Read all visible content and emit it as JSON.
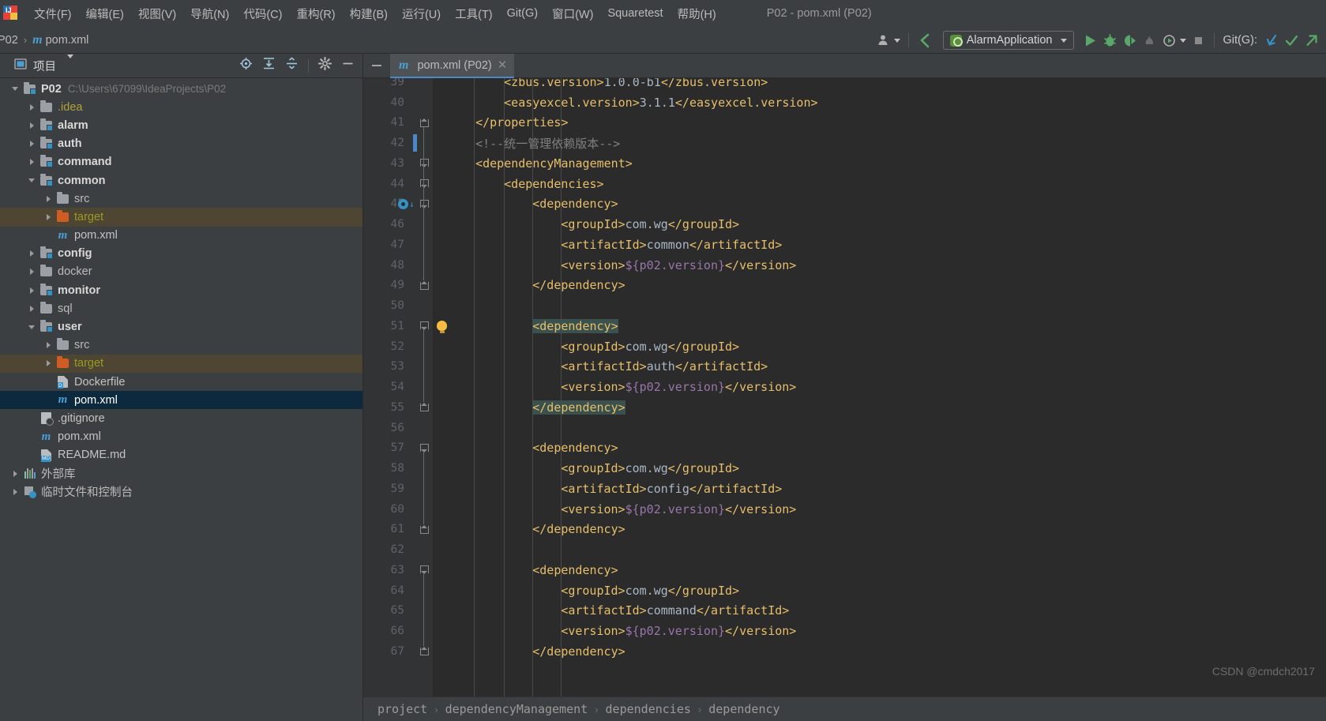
{
  "window": {
    "title": "P02 - pom.xml (P02)"
  },
  "menubar": {
    "logo": "intellij-idea-logo",
    "items": [
      "文件(F)",
      "编辑(E)",
      "视图(V)",
      "导航(N)",
      "代码(C)",
      "重构(R)",
      "构建(B)",
      "运行(U)",
      "工具(T)",
      "Git(G)",
      "窗口(W)",
      "Squaretest",
      "帮助(H)"
    ]
  },
  "navbar": {
    "breadcrumbs": [
      "P02",
      "pom.xml"
    ],
    "separator": "›",
    "toolbar": {
      "user_icon": "user-avatar-icon",
      "back_icon": "back-arrow-icon",
      "run_config": "AlarmApplication",
      "run_icon": "run-icon",
      "debug_icon": "debug-icon",
      "run_coverage_icon": "run-with-coverage-icon",
      "profiler_icon": "profiler-icon",
      "more_run_icon": "run-more-icon",
      "stop_icon": "stop-icon",
      "git_label": "Git(G):",
      "git_update_icon": "git-update-project-icon",
      "git_commit_icon": "git-commit-icon",
      "git_push_icon": "git-push-icon"
    }
  },
  "project_panel": {
    "title": "项目",
    "view_icon": "project-view-icon",
    "dropdown_icon": "chevron-down-icon",
    "actions": [
      "scroll-from-source-icon",
      "expand-all-icon",
      "collapse-all-icon",
      "settings-gear-icon",
      "hide-panel-icon"
    ],
    "tree": [
      {
        "label": "P02",
        "path": "C:\\Users\\67099\\IdeaProjects\\P02",
        "depth": 0,
        "twisty": "down",
        "icon": "module-folder-icon",
        "style": "bold"
      },
      {
        "label": ".idea",
        "depth": 1,
        "twisty": "right",
        "icon": "folder-icon",
        "style": "idea"
      },
      {
        "label": "alarm",
        "depth": 1,
        "twisty": "right",
        "icon": "module-folder-icon",
        "style": "bold"
      },
      {
        "label": "auth",
        "depth": 1,
        "twisty": "right",
        "icon": "module-folder-icon",
        "style": "bold"
      },
      {
        "label": "command",
        "depth": 1,
        "twisty": "right",
        "icon": "module-folder-icon",
        "style": "bold"
      },
      {
        "label": "common",
        "depth": 1,
        "twisty": "down",
        "icon": "module-folder-icon",
        "style": "bold"
      },
      {
        "label": "src",
        "depth": 2,
        "twisty": "right",
        "icon": "folder-icon",
        "style": "plain"
      },
      {
        "label": "target",
        "depth": 2,
        "twisty": "right",
        "icon": "excluded-folder-icon",
        "style": "excluded",
        "row": "excluded"
      },
      {
        "label": "pom.xml",
        "depth": 2,
        "twisty": "none",
        "icon": "maven-file-icon",
        "style": "file"
      },
      {
        "label": "config",
        "depth": 1,
        "twisty": "right",
        "icon": "module-folder-icon",
        "style": "bold"
      },
      {
        "label": "docker",
        "depth": 1,
        "twisty": "right",
        "icon": "folder-icon",
        "style": "plain"
      },
      {
        "label": "monitor",
        "depth": 1,
        "twisty": "right",
        "icon": "module-folder-icon",
        "style": "bold"
      },
      {
        "label": "sql",
        "depth": 1,
        "twisty": "right",
        "icon": "folder-icon",
        "style": "plain"
      },
      {
        "label": "user",
        "depth": 1,
        "twisty": "down",
        "icon": "module-folder-icon",
        "style": "bold"
      },
      {
        "label": "src",
        "depth": 2,
        "twisty": "right",
        "icon": "folder-icon",
        "style": "plain"
      },
      {
        "label": "target",
        "depth": 2,
        "twisty": "right",
        "icon": "excluded-folder-icon",
        "style": "excluded",
        "row": "excluded"
      },
      {
        "label": "Dockerfile",
        "depth": 2,
        "twisty": "none",
        "icon": "dockerfile-icon",
        "style": "file"
      },
      {
        "label": "pom.xml",
        "depth": 2,
        "twisty": "none",
        "icon": "maven-file-icon",
        "style": "file",
        "row": "selected"
      },
      {
        "label": ".gitignore",
        "depth": 1,
        "twisty": "none",
        "icon": "gitignore-icon",
        "style": "file"
      },
      {
        "label": "pom.xml",
        "depth": 1,
        "twisty": "none",
        "icon": "maven-file-icon",
        "style": "file"
      },
      {
        "label": "README.md",
        "depth": 1,
        "twisty": "none",
        "icon": "markdown-icon",
        "style": "file"
      },
      {
        "label": "外部库",
        "depth": 0,
        "twisty": "right",
        "icon": "external-libraries-icon",
        "style": "plain"
      },
      {
        "label": "临时文件和控制台",
        "depth": 0,
        "twisty": "right",
        "icon": "scratches-consoles-icon",
        "style": "plain"
      }
    ]
  },
  "editor": {
    "minimize_icon": "minimize-icon",
    "tab": {
      "label": "pom.xml (P02)",
      "icon": "maven-file-icon",
      "close_icon": "close-icon"
    },
    "first_line_number": 39,
    "lines": [
      {
        "n": 39,
        "indent": 8,
        "marker": "",
        "tokens": [
          {
            "t": "tag",
            "v": "<zbus.version>"
          },
          {
            "t": "txt",
            "v": "1.0.0-b1"
          },
          {
            "t": "tag",
            "v": "</zbus.version>"
          }
        ]
      },
      {
        "n": 40,
        "indent": 8,
        "marker": "",
        "tokens": [
          {
            "t": "tag",
            "v": "<easyexcel.version>"
          },
          {
            "t": "txt",
            "v": "3.1.1"
          },
          {
            "t": "tag",
            "v": "</easyexcel.version>"
          }
        ]
      },
      {
        "n": 41,
        "indent": 4,
        "marker": "fold-close",
        "tokens": [
          {
            "t": "tag",
            "v": "</properties>"
          }
        ]
      },
      {
        "n": 42,
        "indent": 4,
        "marker": "",
        "change": true,
        "tokens": [
          {
            "t": "cmt",
            "v": "<!--统一管理依赖版本-->"
          }
        ]
      },
      {
        "n": 43,
        "indent": 4,
        "marker": "fold-open",
        "tokens": [
          {
            "t": "tag",
            "v": "<dependencyManagement>"
          }
        ]
      },
      {
        "n": 44,
        "indent": 8,
        "marker": "fold-open",
        "tokens": [
          {
            "t": "tag",
            "v": "<dependencies>"
          }
        ]
      },
      {
        "n": 45,
        "indent": 12,
        "marker": "fold-open",
        "maven_nav": true,
        "tokens": [
          {
            "t": "tag",
            "v": "<dependency>"
          }
        ]
      },
      {
        "n": 46,
        "indent": 16,
        "marker": "",
        "tokens": [
          {
            "t": "tag",
            "v": "<groupId>"
          },
          {
            "t": "txt",
            "v": "com.wg"
          },
          {
            "t": "tag",
            "v": "</groupId>"
          }
        ]
      },
      {
        "n": 47,
        "indent": 16,
        "marker": "",
        "tokens": [
          {
            "t": "tag",
            "v": "<artifactId>"
          },
          {
            "t": "txt",
            "v": "common"
          },
          {
            "t": "tag",
            "v": "</artifactId>"
          }
        ]
      },
      {
        "n": 48,
        "indent": 16,
        "marker": "",
        "tokens": [
          {
            "t": "tag",
            "v": "<version>"
          },
          {
            "t": "var",
            "v": "${p02.version}"
          },
          {
            "t": "tag",
            "v": "</version>"
          }
        ]
      },
      {
        "n": 49,
        "indent": 12,
        "marker": "fold-close",
        "tokens": [
          {
            "t": "tag",
            "v": "</dependency>"
          }
        ]
      },
      {
        "n": 50,
        "indent": 0,
        "marker": "",
        "tokens": []
      },
      {
        "n": 51,
        "indent": 12,
        "marker": "fold-open",
        "bulb": true,
        "highlight": true,
        "tokens": [
          {
            "t": "tag",
            "v": "<dependency>"
          }
        ]
      },
      {
        "n": 52,
        "indent": 16,
        "marker": "",
        "tokens": [
          {
            "t": "tag",
            "v": "<groupId>"
          },
          {
            "t": "txt",
            "v": "com.wg"
          },
          {
            "t": "tag",
            "v": "</groupId>"
          }
        ]
      },
      {
        "n": 53,
        "indent": 16,
        "marker": "",
        "tokens": [
          {
            "t": "tag",
            "v": "<artifactId>"
          },
          {
            "t": "txt",
            "v": "auth"
          },
          {
            "t": "tag",
            "v": "</artifactId>"
          }
        ]
      },
      {
        "n": 54,
        "indent": 16,
        "marker": "",
        "tokens": [
          {
            "t": "tag",
            "v": "<version>"
          },
          {
            "t": "var",
            "v": "${p02.version}"
          },
          {
            "t": "tag",
            "v": "</version>"
          }
        ]
      },
      {
        "n": 55,
        "indent": 12,
        "marker": "fold-close",
        "highlight": true,
        "tokens": [
          {
            "t": "tag",
            "v": "</dependency>"
          }
        ]
      },
      {
        "n": 56,
        "indent": 0,
        "marker": "",
        "tokens": []
      },
      {
        "n": 57,
        "indent": 12,
        "marker": "fold-open",
        "tokens": [
          {
            "t": "tag",
            "v": "<dependency>"
          }
        ]
      },
      {
        "n": 58,
        "indent": 16,
        "marker": "",
        "tokens": [
          {
            "t": "tag",
            "v": "<groupId>"
          },
          {
            "t": "txt",
            "v": "com.wg"
          },
          {
            "t": "tag",
            "v": "</groupId>"
          }
        ]
      },
      {
        "n": 59,
        "indent": 16,
        "marker": "",
        "tokens": [
          {
            "t": "tag",
            "v": "<artifactId>"
          },
          {
            "t": "txt",
            "v": "config"
          },
          {
            "t": "tag",
            "v": "</artifactId>"
          }
        ]
      },
      {
        "n": 60,
        "indent": 16,
        "marker": "",
        "tokens": [
          {
            "t": "tag",
            "v": "<version>"
          },
          {
            "t": "var",
            "v": "${p02.version}"
          },
          {
            "t": "tag",
            "v": "</version>"
          }
        ]
      },
      {
        "n": 61,
        "indent": 12,
        "marker": "fold-close",
        "tokens": [
          {
            "t": "tag",
            "v": "</dependency>"
          }
        ]
      },
      {
        "n": 62,
        "indent": 0,
        "marker": "",
        "tokens": []
      },
      {
        "n": 63,
        "indent": 12,
        "marker": "fold-open",
        "tokens": [
          {
            "t": "tag",
            "v": "<dependency>"
          }
        ]
      },
      {
        "n": 64,
        "indent": 16,
        "marker": "",
        "tokens": [
          {
            "t": "tag",
            "v": "<groupId>"
          },
          {
            "t": "txt",
            "v": "com.wg"
          },
          {
            "t": "tag",
            "v": "</groupId>"
          }
        ]
      },
      {
        "n": 65,
        "indent": 16,
        "marker": "",
        "tokens": [
          {
            "t": "tag",
            "v": "<artifactId>"
          },
          {
            "t": "txt",
            "v": "command"
          },
          {
            "t": "tag",
            "v": "</artifactId>"
          }
        ]
      },
      {
        "n": 66,
        "indent": 16,
        "marker": "",
        "tokens": [
          {
            "t": "tag",
            "v": "<version>"
          },
          {
            "t": "var",
            "v": "${p02.version}"
          },
          {
            "t": "tag",
            "v": "</version>"
          }
        ]
      },
      {
        "n": 67,
        "indent": 12,
        "marker": "fold-close",
        "tokens": [
          {
            "t": "tag",
            "v": "</dependency>"
          }
        ]
      }
    ],
    "bottom_breadcrumb": [
      "project",
      "dependencyManagement",
      "dependencies",
      "dependency"
    ],
    "breadcrumb_separator": "›"
  },
  "watermark": "CSDN @cmdch2017",
  "colors": {
    "panel_bg": "#3c3f41",
    "editor_bg": "#2b2b2b",
    "gutter_bg": "#313335",
    "selection": "#0d293e",
    "excluded_row": "#4e4633",
    "tag": "#e8bf6a",
    "text": "#a9b7c6",
    "comment": "#808080",
    "variable": "#9876aa",
    "accent_blue": "#4a88c7",
    "brace_match": "#3b514d",
    "run_green": "#59a869"
  }
}
